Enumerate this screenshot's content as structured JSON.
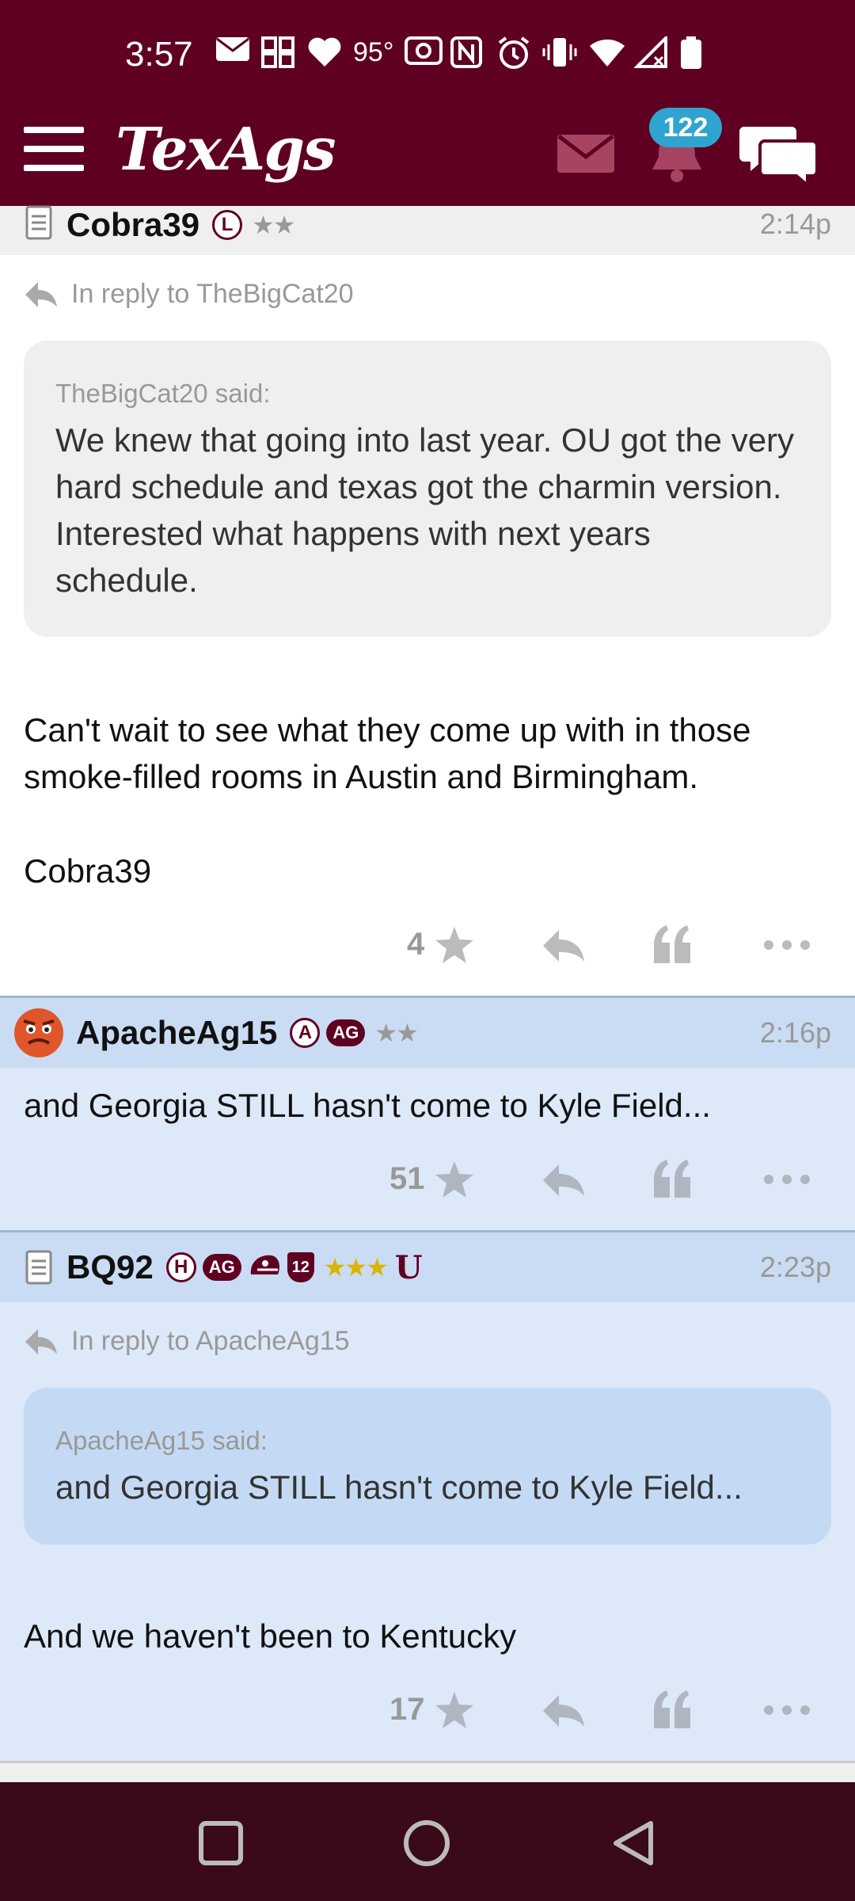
{
  "status_bar": {
    "time": "3:57",
    "temperature": "95°",
    "icons": [
      "mail-icon",
      "grid-icon",
      "heart-icon",
      "camera-icon",
      "nfc-icon",
      "alarm-icon",
      "vibrate-icon",
      "wifi-icon",
      "signal-icon",
      "battery-icon"
    ]
  },
  "header": {
    "logo": "TexAgs",
    "notification_count": "122",
    "brand_color": "#5f0022"
  },
  "posts": [
    {
      "username": "Cobra39",
      "badge": "L",
      "stars": "★★",
      "time": "2:14p",
      "reply_to": "In reply to TheBigCat20",
      "quote_author": "TheBigCat20 said:",
      "quote_text": "We knew that going into last year. OU got the very hard schedule and texas got the charmin version. Interested what happens with next years schedule.",
      "body": "Can't wait to see what they come up with in those smoke-filled rooms in Austin and Birmingham.",
      "signature": "Cobra39",
      "votes": "4"
    },
    {
      "username": "ApacheAg15",
      "badge": "A",
      "ag_badge": "AG",
      "stars": "★★",
      "time": "2:16p",
      "body": "and Georgia STILL hasn't come to Kyle Field...",
      "votes": "51"
    },
    {
      "username": "BQ92",
      "badge": "H",
      "ag_badge": "AG",
      "team_badge": "12",
      "stars": "★★★",
      "time": "2:23p",
      "reply_to": "In reply to ApacheAg15",
      "quote_author": "ApacheAg15 said:",
      "quote_text": "and Georgia STILL hasn't come to Kyle Field...",
      "body": "And we haven't been to Kentucky",
      "votes": "17"
    }
  ]
}
